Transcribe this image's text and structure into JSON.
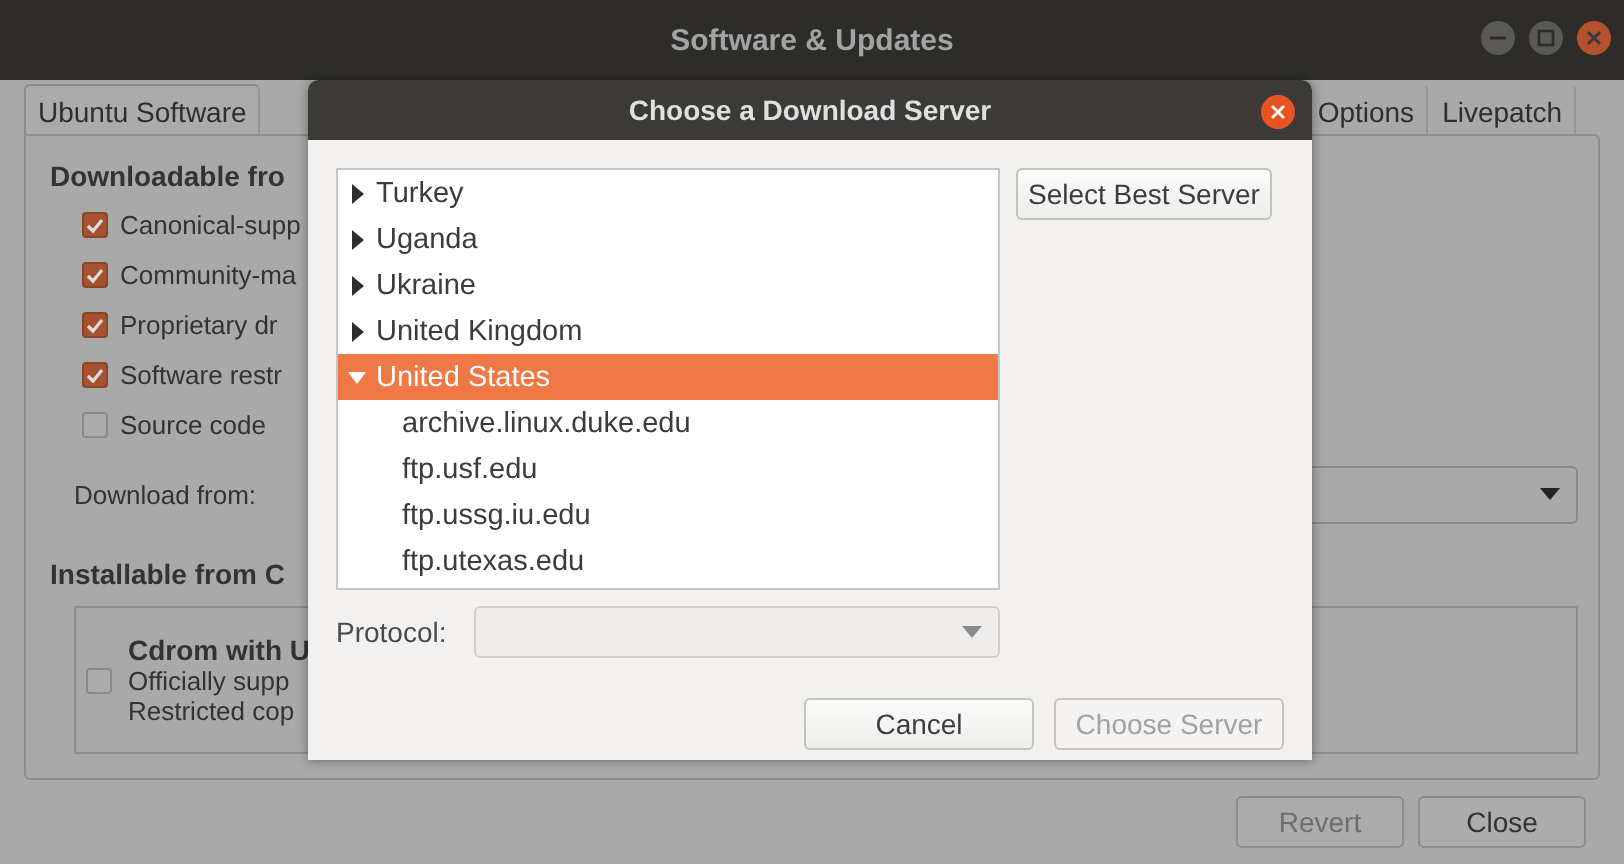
{
  "window": {
    "title": "Software & Updates"
  },
  "tabs": [
    {
      "label": "Ubuntu Software",
      "selected": true
    },
    {
      "label": "Options",
      "selected": false
    },
    {
      "label": "Livepatch",
      "selected": false
    }
  ],
  "downloadable": {
    "heading": "Downloadable fro",
    "options": [
      {
        "label": "Canonical-supp",
        "checked": true
      },
      {
        "label": "Community-ma",
        "checked": true
      },
      {
        "label": "Proprietary dr",
        "checked": true
      },
      {
        "label": "Software restr",
        "checked": true
      },
      {
        "label": "Source code",
        "checked": false
      }
    ],
    "download_from": {
      "label": "Download from:"
    }
  },
  "installable": {
    "heading": "Installable from C",
    "cdrom": {
      "title": "Cdrom with U",
      "lines": [
        "Officially supp",
        "Restricted cop"
      ],
      "checked": false
    }
  },
  "buttons": [
    {
      "label": "Revert",
      "disabled": true
    },
    {
      "label": "Close",
      "disabled": false
    }
  ],
  "dialog": {
    "title": "Choose a Download Server",
    "tree": [
      {
        "label": "Turkey",
        "expanded": false,
        "selected": false
      },
      {
        "label": "Uganda",
        "expanded": false,
        "selected": false
      },
      {
        "label": "Ukraine",
        "expanded": false,
        "selected": false
      },
      {
        "label": "United Kingdom",
        "expanded": false,
        "selected": false
      },
      {
        "label": "United States",
        "expanded": true,
        "selected": true,
        "children": [
          {
            "label": "archive.linux.duke.edu",
            "selected": false
          },
          {
            "label": "ftp.usf.edu",
            "selected": false
          },
          {
            "label": "ftp.ussg.iu.edu",
            "selected": false
          },
          {
            "label": "ftp.utexas.edu",
            "selected": false
          }
        ]
      }
    ],
    "select_best": "Select Best Server",
    "protocol": {
      "label": "Protocol:",
      "disabled": true
    },
    "buttons": [
      {
        "label": "Cancel",
        "disabled": false
      },
      {
        "label": "Choose Server",
        "disabled": true
      }
    ]
  }
}
